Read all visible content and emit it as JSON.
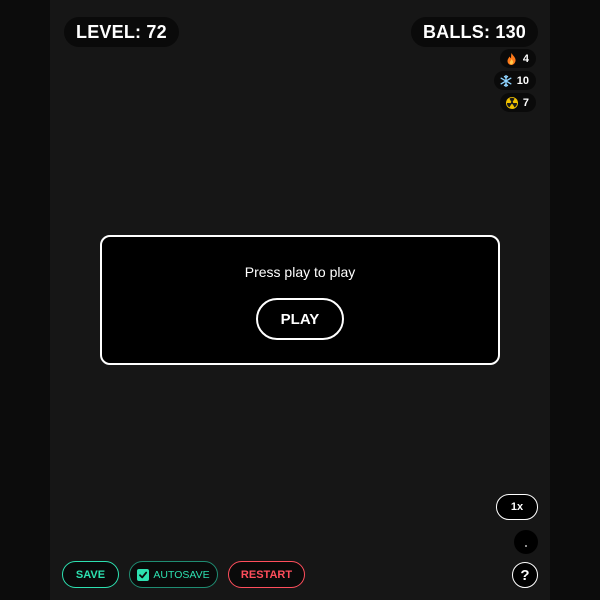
{
  "hud": {
    "level": "LEVEL: 72",
    "balls": "BALLS: 130"
  },
  "powerups": [
    {
      "icon": "fire-icon",
      "count": "4",
      "color": "#ff7a1a"
    },
    {
      "icon": "snowflake-icon",
      "count": "10",
      "color": "#8fd3ff"
    },
    {
      "icon": "radiation-icon",
      "count": "7",
      "color": "#f2c200"
    }
  ],
  "modal": {
    "message": "Press play to play",
    "play_label": "PLAY"
  },
  "controls": {
    "speed_label": "1x",
    "help_label": "?"
  },
  "bottom_bar": {
    "save_label": "SAVE",
    "autosave_label": "AUTOSAVE",
    "autosave_checked": true,
    "restart_label": "RESTART"
  },
  "colors": {
    "save_accent": "#2de0b0",
    "restart_accent": "#ff4e5c",
    "background": "#161616"
  }
}
